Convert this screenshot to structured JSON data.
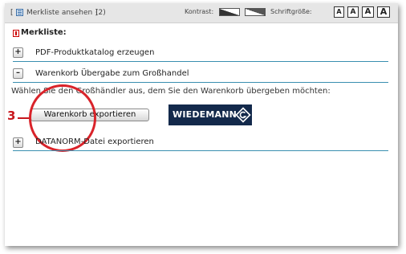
{
  "topbar": {
    "bracket_open": "[",
    "merkliste_link": "Merkliste ansehen ]",
    "merkliste_count": "(2)",
    "kontrast_label": "Kontrast:",
    "schriftgroesse_label": "Schriftgröße:",
    "font_size_buttons": [
      "A",
      "A",
      "A",
      "A"
    ]
  },
  "merkliste": {
    "heading": "Merkliste:",
    "sections": [
      {
        "toggle": "+",
        "label": "PDF-Produktkatalog erzeugen"
      },
      {
        "toggle": "–",
        "label": "Warenkorb Übergabe zum Großhandel"
      },
      {
        "toggle": "+",
        "label": "DATANORM-Datei exportieren"
      }
    ],
    "info_text": "Wählen Sie den Großhändler aus, dem Sie den Warenkorb übergeben möchten:",
    "export_button": "Warenkorb exportieren",
    "wholesaler_logo_text": "WIEDEMANN"
  },
  "annotation": {
    "step_number": "3",
    "color": "#c8171d"
  },
  "colors": {
    "separator": "#3a8fb0",
    "logo_bg": "#13294b"
  },
  "icons": {
    "merkliste": "list-icon",
    "heading": "info-icon",
    "logo": "wiedemann-logo-icon"
  }
}
